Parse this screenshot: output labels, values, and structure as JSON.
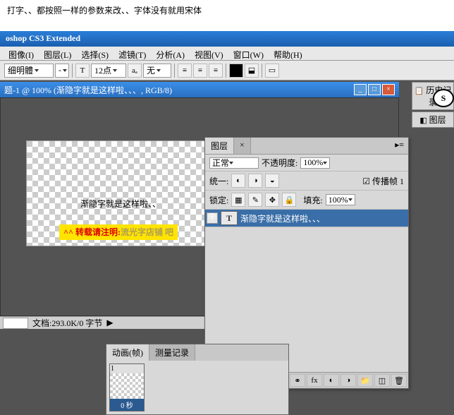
{
  "top_note": "打字、、都按照一样的参数来改、、字体没有就用宋体",
  "app_title": "oshop CS3 Extended",
  "menu": [
    "图像(I)",
    "图层(L)",
    "选择(S)",
    "滤镜(T)",
    "分析(A)",
    "视图(V)",
    "窗口(W)",
    "帮助(H)"
  ],
  "opt": {
    "font": "细明體",
    "size": "12点",
    "aa": "无"
  },
  "doc_title": "题-1 @ 100% (渐隐字就是这样啦、、、, RGB/8)",
  "canvas_text": "渐隐字就是这样啦、、",
  "overlay": {
    "p1": "^^ 转载请注明:",
    "p2": "流光字店铺  吧"
  },
  "status": {
    "doc": "文档:293.0K/0 字节"
  },
  "rp": {
    "hist": "历史记录",
    "layers": "图层"
  },
  "layers": {
    "tab": "图层",
    "tab2": "×",
    "mode": "正常",
    "opacity_l": "不透明度:",
    "opacity": "100%",
    "unify": "统一:",
    "prop": "传播帧 1",
    "lock": "锁定:",
    "fill_l": "填充:",
    "fill": "100%",
    "item": "渐隐字就是这样啦、、、"
  },
  "anim": {
    "t1": "动画(帧)",
    "t2": "测量记录",
    "n": "1",
    "time": "0 秒"
  },
  "skype": "S"
}
